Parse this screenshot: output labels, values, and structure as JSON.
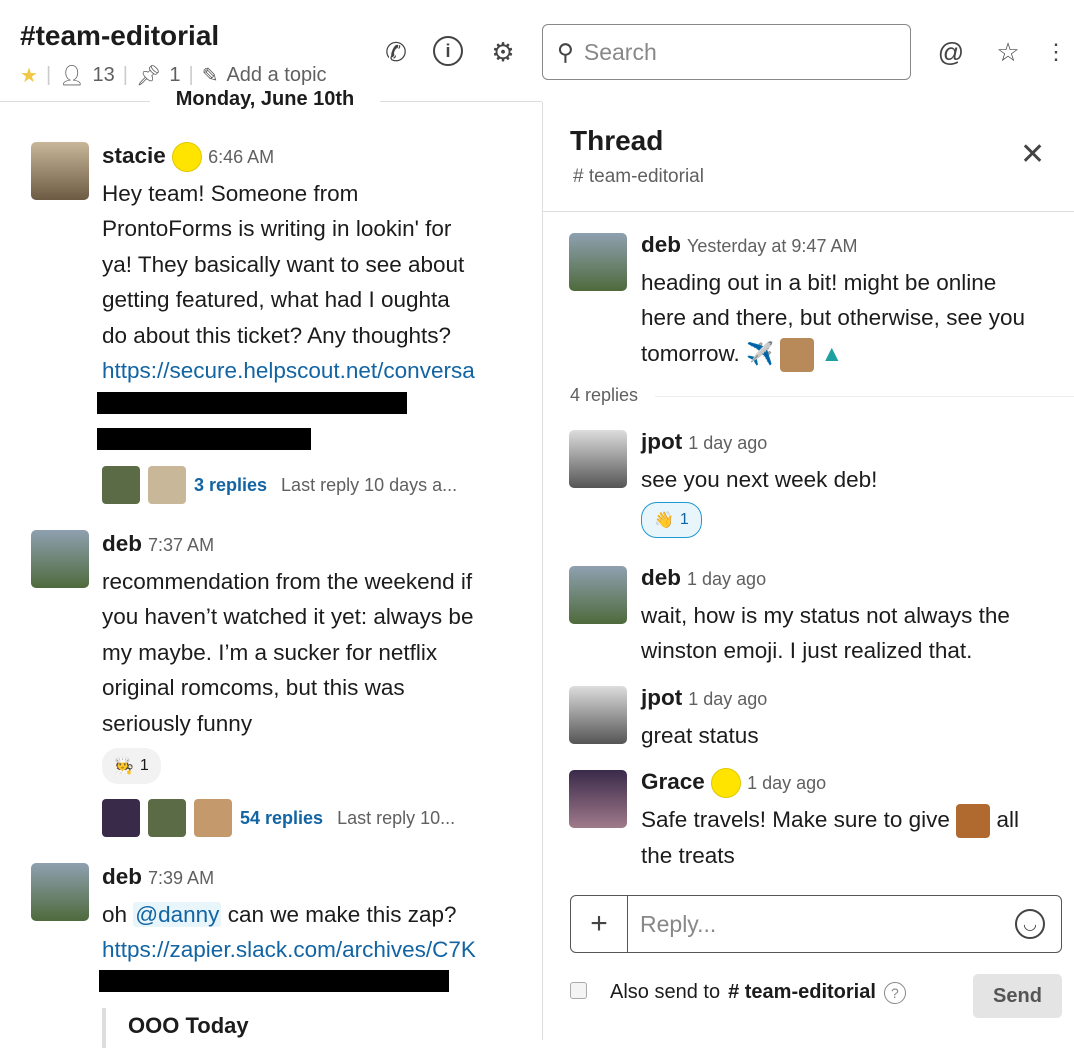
{
  "channel": {
    "name": "#team-editorial",
    "members": "13",
    "pins": "1",
    "topic": "Add a topic"
  },
  "search": {
    "placeholder": "Search"
  },
  "date_divider": "Monday, June 10th",
  "messages": [
    {
      "author": "stacie",
      "time": "6:46 AM",
      "text": [
        "Hey team! Someone from",
        "ProntoForms is writing in lookin' for",
        "ya! They basically want to see about",
        "getting featured, what had I oughta",
        "do about this ticket? Any thoughts?"
      ],
      "link": "https://secure.helpscout.net/conversa",
      "replies": "3 replies",
      "last_reply": "Last reply 10 days a..."
    },
    {
      "author": "deb",
      "time": "7:37 AM",
      "text": [
        "recommendation from the weekend if",
        "you haven’t watched it yet: always be",
        "my maybe. I’m a sucker for netflix",
        "original romcoms, but this was",
        "seriously funny"
      ],
      "reaction_count": "1",
      "replies": "54 replies",
      "last_reply": "Last reply 10..."
    },
    {
      "author": "deb",
      "time": "7:39 AM",
      "text_pre": "oh ",
      "mention": "@danny",
      "text_post": " can we make this zap?",
      "link": "https://zapier.slack.com/archives/C7K",
      "quote": "OOO Today"
    }
  ],
  "thread": {
    "title": "Thread",
    "channel": "# team-editorial",
    "parent": {
      "author": "deb",
      "time": "Yesterday at 9:47 AM",
      "text": [
        "heading out in a bit! might be online",
        "here and there, but otherwise, see you",
        "tomorrow."
      ]
    },
    "reply_count": "4 replies",
    "replies": [
      {
        "author": "jpot",
        "time": "1 day ago",
        "text": [
          "see you next week deb!"
        ],
        "reaction_count": "1"
      },
      {
        "author": "deb",
        "time": "1 day ago",
        "text": [
          "wait, how is my status not always the",
          "winston emoji. I just realized that."
        ]
      },
      {
        "author": "jpot",
        "time": "1 day ago",
        "text": [
          "great status"
        ]
      },
      {
        "author": "Grace",
        "time": "1 day ago",
        "text_pre": "Safe travels! Make sure to give",
        "text_post": "all",
        "text2": "the treats"
      }
    ],
    "composer": {
      "placeholder": "Reply...",
      "also_send": "Also send to",
      "also_channel": "# team-editorial",
      "send": "Send"
    }
  },
  "colors": {
    "link": "#1264a3",
    "star": "#f2c744",
    "accent": "#1d9bd1"
  }
}
